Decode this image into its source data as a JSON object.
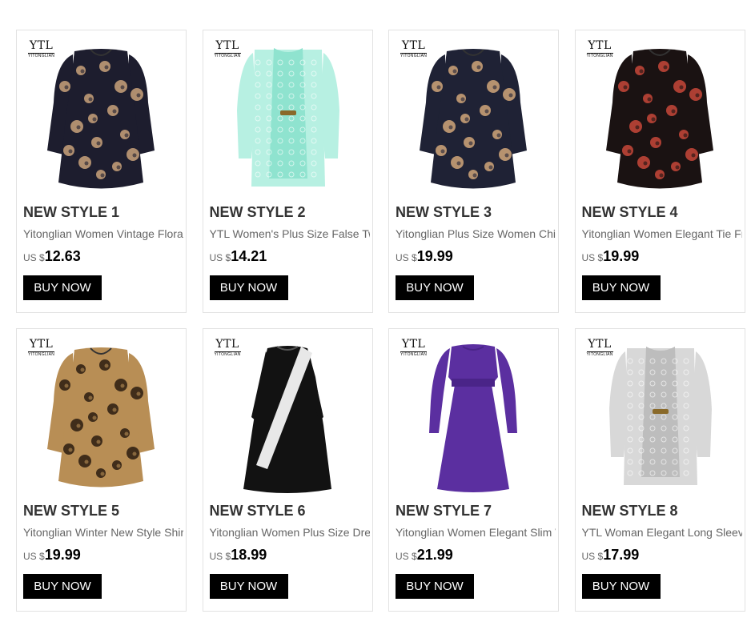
{
  "products": [
    {
      "title": "NEW STYLE 1",
      "desc": "Yitonglian Women Vintage Floral Print Tops",
      "currency": "US $",
      "price": "12.63",
      "buy": "BUY NOW",
      "brand": "YTL",
      "brand_sub": "YITONGLIAN",
      "image": "floral-navy-tunic",
      "colors": {
        "base": "#1d1d2e",
        "accent": "#c9a27a"
      }
    },
    {
      "title": "NEW STYLE 2",
      "desc": "YTL Women's Plus Size False Two-piece Lace Top",
      "currency": "US $",
      "price": "14.21",
      "buy": "BUY NOW",
      "brand": "YTL",
      "brand_sub": "YITONGLIAN",
      "image": "mint-lace-cardigan-top",
      "colors": {
        "base": "#8fe3cf",
        "accent": "#b7f0e2"
      }
    },
    {
      "title": "NEW STYLE 3",
      "desc": "Yitonglian Plus Size Women Chiffon Floral Blouse",
      "currency": "US $",
      "price": "19.99",
      "buy": "BUY NOW",
      "brand": "YTL",
      "brand_sub": "YITONGLIAN",
      "image": "floral-chiffon-blouse",
      "colors": {
        "base": "#1f2235",
        "accent": "#d1a679"
      }
    },
    {
      "title": "NEW STYLE 4",
      "desc": "Yitonglian Women Elegant Tie Front Floral Blouse",
      "currency": "US $",
      "price": "19.99",
      "buy": "BUY NOW",
      "brand": "YTL",
      "brand_sub": "YITONGLIAN",
      "image": "black-red-floral-blouse",
      "colors": {
        "base": "#1a1212",
        "accent": "#c8483a"
      }
    },
    {
      "title": "NEW STYLE 5",
      "desc": "Yitonglian Winter New Style Shirts Leopard Print",
      "currency": "US $",
      "price": "19.99",
      "buy": "BUY NOW",
      "brand": "YTL",
      "brand_sub": "YITONGLIAN",
      "image": "leopard-print-top",
      "colors": {
        "base": "#b88e55",
        "accent": "#2a1c10"
      }
    },
    {
      "title": "NEW STYLE 6",
      "desc": "Yitonglian Women Plus Size Dress Long Sleeve",
      "currency": "US $",
      "price": "18.99",
      "buy": "BUY NOW",
      "brand": "YTL",
      "brand_sub": "YITONGLIAN",
      "image": "black-white-stripe-dress",
      "colors": {
        "base": "#121212",
        "accent": "#e8e8e8"
      }
    },
    {
      "title": "NEW STYLE 7",
      "desc": "Yitonglian Women Elegant Slim Waist Dress",
      "currency": "US $",
      "price": "21.99",
      "buy": "BUY NOW",
      "brand": "YTL",
      "brand_sub": "YITONGLIAN",
      "image": "purple-long-sleeve-dress",
      "colors": {
        "base": "#5b2fa0",
        "accent": "#4a2488"
      }
    },
    {
      "title": "NEW STYLE 8",
      "desc": "YTL Woman Elegant Long Sleeve Lace Cardigan",
      "currency": "US $",
      "price": "17.99",
      "buy": "BUY NOW",
      "brand": "YTL",
      "brand_sub": "YITONGLIAN",
      "image": "grey-lace-cardigan-top",
      "colors": {
        "base": "#bdbdbd",
        "accent": "#d8d8d8"
      }
    }
  ]
}
